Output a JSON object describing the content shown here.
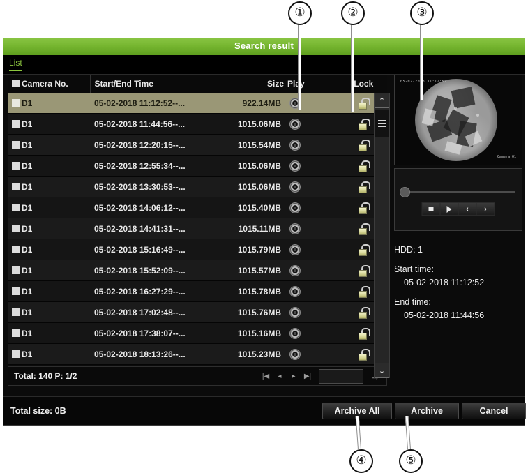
{
  "window": {
    "title": "Search result",
    "tab_label": "List"
  },
  "table": {
    "headers": {
      "camera": "Camera No.",
      "time": "Start/End Time",
      "size": "Size",
      "play": "Play",
      "lock": "Lock"
    },
    "rows": [
      {
        "camera": "D1",
        "time": "05-02-2018 11:12:52--...",
        "size": "922.14MB",
        "selected": true
      },
      {
        "camera": "D1",
        "time": "05-02-2018 11:44:56--...",
        "size": "1015.06MB",
        "selected": false
      },
      {
        "camera": "D1",
        "time": "05-02-2018 12:20:15--...",
        "size": "1015.54MB",
        "selected": false
      },
      {
        "camera": "D1",
        "time": "05-02-2018 12:55:34--...",
        "size": "1015.06MB",
        "selected": false
      },
      {
        "camera": "D1",
        "time": "05-02-2018 13:30:53--...",
        "size": "1015.06MB",
        "selected": false
      },
      {
        "camera": "D1",
        "time": "05-02-2018 14:06:12--...",
        "size": "1015.40MB",
        "selected": false
      },
      {
        "camera": "D1",
        "time": "05-02-2018 14:41:31--...",
        "size": "1015.11MB",
        "selected": false
      },
      {
        "camera": "D1",
        "time": "05-02-2018 15:16:49--...",
        "size": "1015.79MB",
        "selected": false
      },
      {
        "camera": "D1",
        "time": "05-02-2018 15:52:09--...",
        "size": "1015.57MB",
        "selected": false
      },
      {
        "camera": "D1",
        "time": "05-02-2018 16:27:29--...",
        "size": "1015.78MB",
        "selected": false
      },
      {
        "camera": "D1",
        "time": "05-02-2018 17:02:48--...",
        "size": "1015.76MB",
        "selected": false
      },
      {
        "camera": "D1",
        "time": "05-02-2018 17:38:07--...",
        "size": "1015.16MB",
        "selected": false
      },
      {
        "camera": "D1",
        "time": "05-02-2018 18:13:26--...",
        "size": "1015.23MB",
        "selected": false
      }
    ]
  },
  "list_footer": {
    "total_text": "Total: 140  P: 1/2",
    "page_input_value": "",
    "pager": {
      "first": "|◀",
      "prev": "◂",
      "next": "▸",
      "last": "▶|",
      "go": "→"
    }
  },
  "scrollbar": {
    "up": "⌃",
    "down": "⌄"
  },
  "preview": {
    "overlay_timestamp": "05-02-2018 11:12:52",
    "overlay_camera": "Camera 01"
  },
  "playback_controls": {
    "stop": "stop-icon",
    "play": "play-icon",
    "prev": "‹",
    "next": "›"
  },
  "info": {
    "hdd": "HDD: 1",
    "start_label": "Start time:",
    "start_value": "05-02-2018 11:12:52",
    "end_label": "End time:",
    "end_value": "05-02-2018 11:44:56"
  },
  "bottom": {
    "total_size": "Total size: 0B",
    "archive_all": "Archive All",
    "archive": "Archive",
    "cancel": "Cancel"
  },
  "callouts": {
    "one": "①",
    "two": "②",
    "three": "③",
    "four": "④",
    "five": "⑤"
  },
  "colors": {
    "title_green": "#76b630",
    "tab_green": "#8cc63f",
    "selected_row": "#9a9776",
    "panel_dark": "#0b0b0b"
  }
}
